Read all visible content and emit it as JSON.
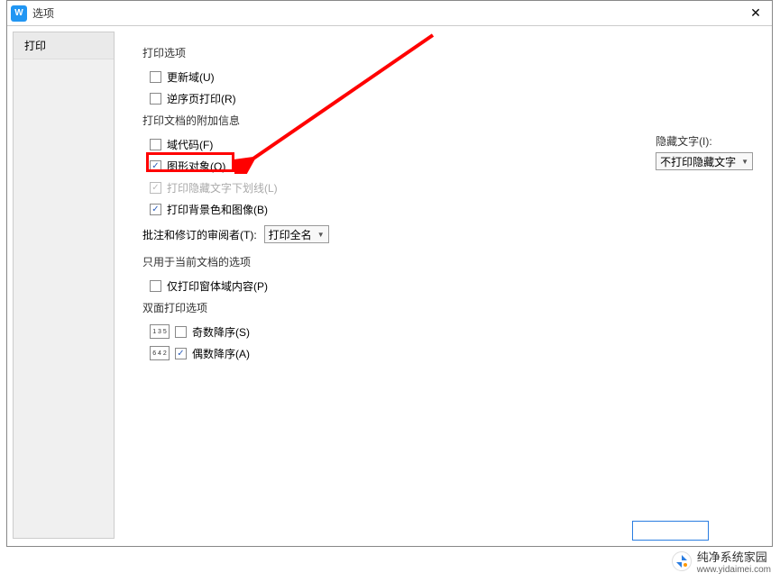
{
  "window": {
    "title": "选项",
    "icon_letter": "W"
  },
  "sidebar": {
    "active": "打印"
  },
  "sections": {
    "print_options": {
      "title": "打印选项",
      "update_fields": {
        "label": "更新域(U)",
        "checked": false
      },
      "reverse_order": {
        "label": "逆序页打印(R)",
        "checked": false
      }
    },
    "doc_extras": {
      "title": "打印文档的附加信息",
      "field_codes": {
        "label": "域代码(F)",
        "checked": false
      },
      "drawing_objects": {
        "label": "图形对象(O)",
        "checked": true
      },
      "hidden_text_underline": {
        "label": "打印隐藏文字下划线(L)",
        "checked": true,
        "disabled": true
      },
      "background": {
        "label": "打印背景色和图像(B)",
        "checked": true
      }
    },
    "reviewer": {
      "label": "批注和修订的审阅者(T):",
      "value": "打印全名"
    },
    "hidden_text": {
      "label": "隐藏文字(I):",
      "value": "不打印隐藏文字"
    },
    "current_doc": {
      "title": "只用于当前文档的选项",
      "print_form_only": {
        "label": "仅打印窗体域内容(P)",
        "checked": false
      }
    },
    "duplex": {
      "title": "双面打印选项",
      "odd_desc": {
        "label": "奇数降序(S)",
        "checked": false,
        "icon_text": "1 3 5"
      },
      "even_desc": {
        "label": "偶数降序(A)",
        "checked": true,
        "icon_text": "6 4 2"
      }
    }
  },
  "watermark": {
    "brand": "纯净系统家园",
    "url": "www.yidaimei.com"
  }
}
